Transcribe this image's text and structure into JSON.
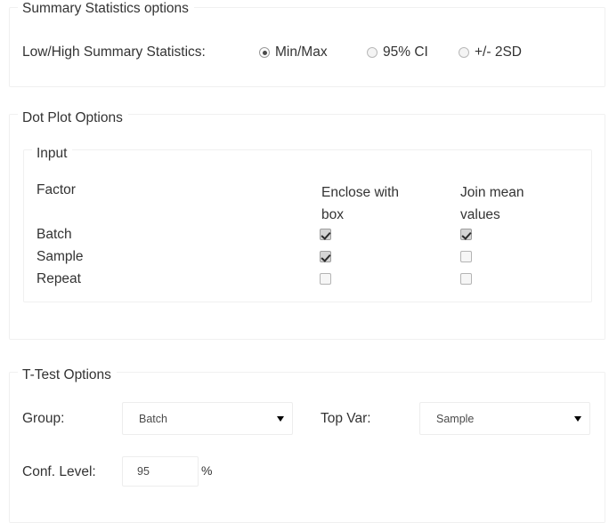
{
  "summary_section": {
    "legend": "Summary Statistics options",
    "row_label": "Low/High Summary Statistics:",
    "options": [
      {
        "label": "Min/Max",
        "selected": true
      },
      {
        "label": "95% CI",
        "selected": false
      },
      {
        "label": "+/- 2SD",
        "selected": false
      }
    ]
  },
  "dot_plot_section": {
    "legend": "Dot Plot Options",
    "input_legend": "Input",
    "columns": {
      "factor": "Factor",
      "enclose": "Enclose with box",
      "join": "Join mean values"
    },
    "rows": [
      {
        "factor": "Batch",
        "enclose_with_box": true,
        "join_mean_values": true
      },
      {
        "factor": "Sample",
        "enclose_with_box": true,
        "join_mean_values": false
      },
      {
        "factor": "Repeat",
        "enclose_with_box": false,
        "join_mean_values": false
      }
    ]
  },
  "ttest_section": {
    "legend": "T-Test Options",
    "group": {
      "label": "Group:",
      "value": "Batch"
    },
    "top_var": {
      "label": "Top Var:",
      "value": "Sample"
    },
    "conf_level": {
      "label": "Conf. Level:",
      "value": "95",
      "unit": "%"
    }
  },
  "colors": {
    "border": "#f0f0f0",
    "text": "#333333",
    "background": "#ffffff"
  }
}
